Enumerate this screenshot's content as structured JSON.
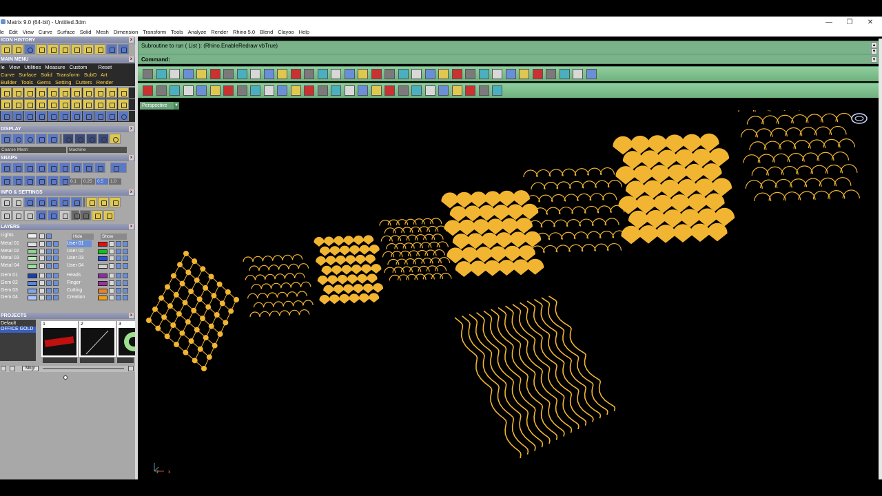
{
  "window": {
    "title": "Matrix 9.0 (64-bit) - Untitled.3dm",
    "controls": [
      "—",
      "❐",
      "✕"
    ]
  },
  "menubar": [
    "le",
    "Edit",
    "View",
    "Curve",
    "Surface",
    "Solid",
    "Mesh",
    "Dimension",
    "Transform",
    "Tools",
    "Analyze",
    "Render",
    "Rhino 5.0",
    "Blend",
    "Clayoo",
    "Help"
  ],
  "panels": {
    "icon_history": "ICON HISTORY",
    "main_menu": "MAIN MENU",
    "main_menu_row1": [
      "le",
      "View",
      "Utilities",
      "Measure",
      "Custom",
      "Reset"
    ],
    "main_menu_row2": [
      "Curve",
      "Surface",
      "Solid",
      "Transform",
      "SubD",
      "Art"
    ],
    "main_menu_row3": [
      "Builder",
      "Tools",
      "Gems",
      "Setting",
      "Cutters",
      "Render"
    ],
    "display": "DISPLAY",
    "display_fields": [
      "Coarse Mesh",
      "Machine"
    ],
    "snaps": "SNAPS",
    "snap_values": [
      "0.1",
      "0.25",
      "0.5",
      "1.0"
    ],
    "info_settings": "INFO & SETTINGS",
    "layers": "LAYERS",
    "layers_lights": "Lights",
    "layers_hide": "Hide",
    "layers_show": "Show",
    "layers_left": [
      "Metal 01",
      "Metal 02",
      "Metal 03",
      "Metal 04",
      "Gem 01",
      "Gem 02",
      "Gem 03",
      "Gem 04"
    ],
    "layers_right": [
      "User 01",
      "User 02",
      "User 03",
      "User 04",
      "Heads",
      "Finger",
      "Cutting",
      "Creation"
    ],
    "layers_left_colors": [
      "#e0e0e0",
      "#8fd18f",
      "#b8e8b8",
      "#9de09d",
      "#1c3fa8",
      "#5a85e0",
      "#7fa6f0",
      "#a9c6ff"
    ],
    "layers_right_colors": [
      "#e01010",
      "#10c020",
      "#2050e0",
      "#d0d0d0",
      "#8a2fa0",
      "#a030a0",
      "#f08020",
      "#f0a010"
    ],
    "projects": "PROJECTS",
    "project_list": [
      "Default",
      "OFFICE GOLD"
    ],
    "project_thumbs": [
      "1",
      "2",
      "3"
    ],
    "mngr": "Mngr"
  },
  "command": {
    "history_line": "Subroutine to run ( List ): (Rhino.EnableRedraw vbTrue)",
    "prompt_label": "Command:"
  },
  "viewport": {
    "label": "Perspective",
    "gold": "#f2b532",
    "axis_z": "z",
    "axis_x": "x"
  }
}
